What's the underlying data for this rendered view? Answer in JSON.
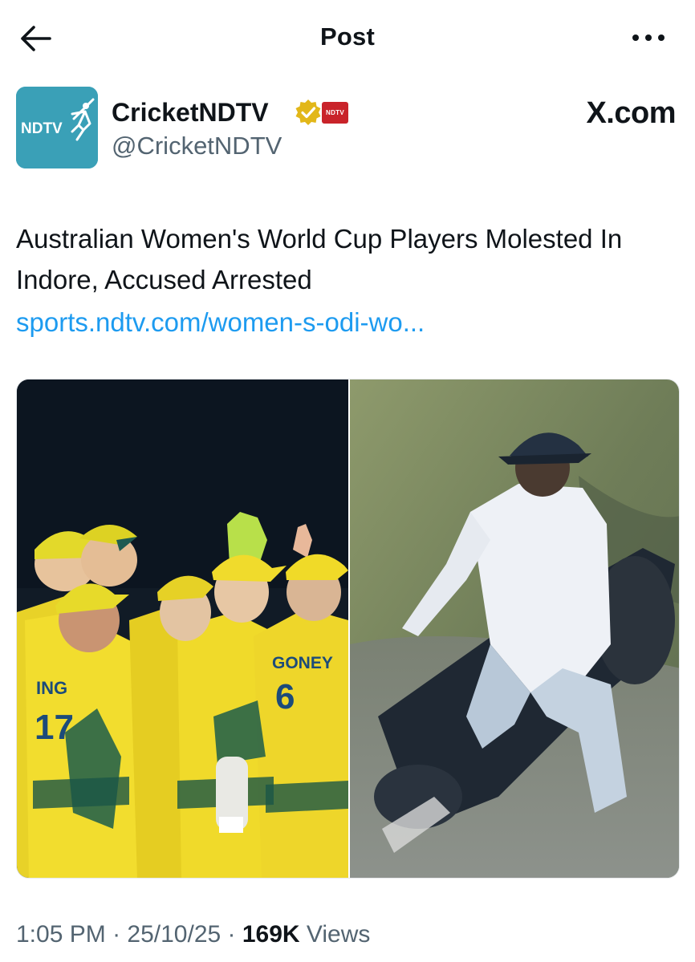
{
  "header": {
    "title": "Post"
  },
  "author": {
    "display_name": "CricketNDTV",
    "handle": "@CricketNDTV",
    "avatar_text": "NDTV",
    "affiliate_badge_text": "NDTV",
    "source_label": "X.com"
  },
  "post": {
    "text": "Australian Women's World Cup Players Molested In Indore, Accused Arrested",
    "link": "sports.ndtv.com/women-s-odi-wo..."
  },
  "meta": {
    "time": "1:05 PM",
    "date": "25/10/25",
    "views_count": "169K",
    "views_label": "Views"
  },
  "colors": {
    "link": "#1d9bf0",
    "secondary_text": "#536471",
    "verified_gold": "#e2b719",
    "avatar_bg": "#3aa0b7",
    "ndtv_red": "#c9232a"
  },
  "icons": [
    "back-arrow-icon",
    "more-icon",
    "verified-badge-icon"
  ]
}
